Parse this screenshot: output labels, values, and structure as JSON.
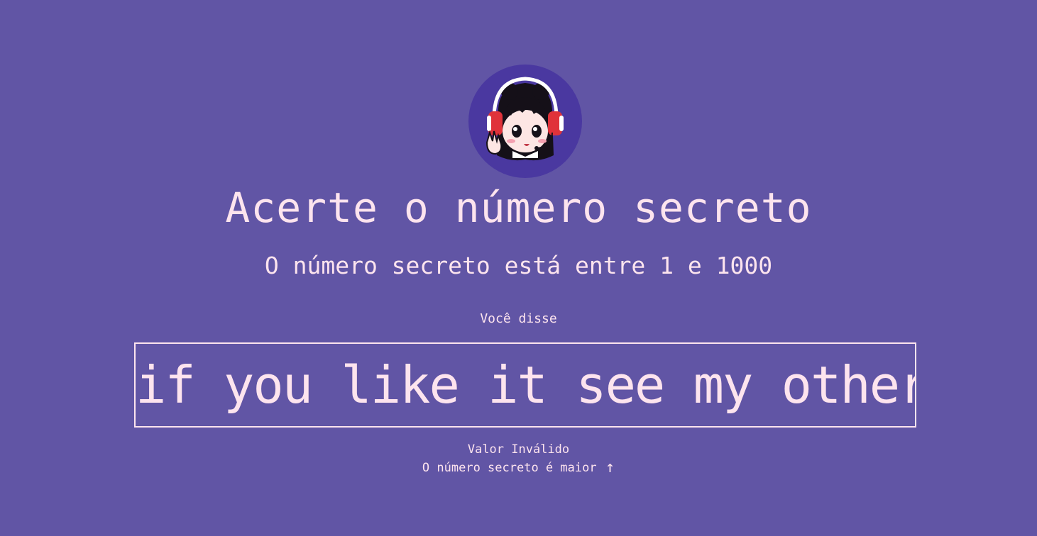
{
  "game": {
    "title": "Acerte o número secreto",
    "subtitle": "O número secreto está entre 1 e 1000",
    "said_label": "Você disse",
    "guess_text": "if you like it see my other projects",
    "feedback_invalid": "Valor Inválido",
    "feedback_direction": "O número secreto é maior",
    "direction_icon": "arrow-up-icon"
  },
  "colors": {
    "background": "#6155a5",
    "text": "#fde4ee",
    "avatar_circle": "#4a38a0",
    "headphones": "#e0323a"
  }
}
